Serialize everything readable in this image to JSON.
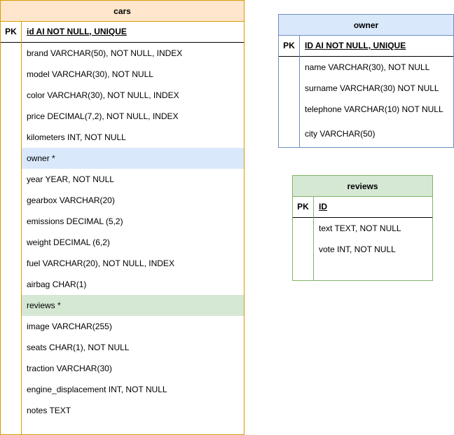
{
  "colors": {
    "cars_border": "#d79b00",
    "cars_header": "#ffe6cc",
    "owner_border": "#6c8ebf",
    "owner_header": "#dae8fc",
    "reviews_border": "#82b366",
    "reviews_header": "#d5e8d4"
  },
  "cars": {
    "title": "cars",
    "pk_label": "PK",
    "pk_field": "id AI  NOT NULL, UNIQUE",
    "fields": [
      "brand VARCHAR(50), NOT NULL, INDEX",
      "model VARCHAR(30), NOT NULL",
      "color VARCHAR(30), NOT NULL, INDEX",
      "price DECIMAL(7,2), NOT NULL, INDEX",
      "kilometers INT, NOT NULL",
      "owner *",
      "year YEAR, NOT NULL",
      "gearbox VARCHAR(20)",
      "emissions DECIMAL (5,2)",
      "weight DECIMAL (6,2)",
      "fuel VARCHAR(20), NOT NULL, INDEX",
      "airbag CHAR(1)",
      "reviews *",
      "image VARCHAR(255)",
      "seats CHAR(1), NOT NULL",
      "traction VARCHAR(30)",
      "engine_displacement INT, NOT NULL",
      "notes TEXT"
    ]
  },
  "owner": {
    "title": "owner",
    "pk_label": "PK",
    "pk_field": "ID AI NOT NULL, UNIQUE",
    "fields": [
      "name VARCHAR(30), NOT NULL",
      "surname VARCHAR(30) NOT NULL",
      "telephone VARCHAR(10) NOT NULL",
      "city VARCHAR(50)"
    ]
  },
  "reviews": {
    "title": "reviews",
    "pk_label": "PK",
    "pk_field": "ID",
    "fields": [
      "text TEXT, NOT NULL",
      "vote INT, NOT NULL"
    ]
  }
}
